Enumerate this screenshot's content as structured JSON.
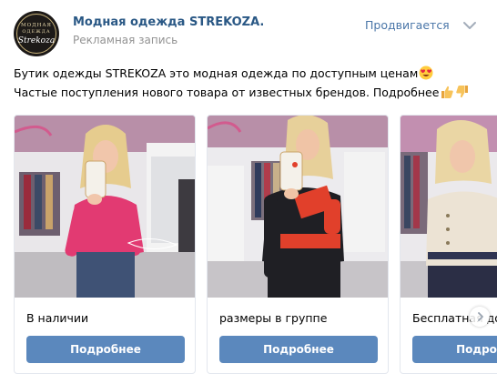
{
  "header": {
    "avatar": {
      "logo_line1": "МОДНАЯ",
      "logo_line2": "ОДЕЖДА",
      "logo_script": "Strekoza"
    },
    "page_name": "Модная одежда STREKOZA.",
    "ad_label": "Рекламная запись",
    "promoted_label": "Продвигается",
    "menu_icon": "chevron-down-icon"
  },
  "post": {
    "text_line1": "Бутик одежды STREKOZA это модная одежда по доступным ценам",
    "text_line2": "Частые поступления нового товара от известных брендов. Подробнее",
    "emojis": [
      "heart-eyes-emoji",
      "thumbs-up-emoji",
      "thumbs-down-emoji"
    ]
  },
  "carousel": {
    "cards": [
      {
        "caption": "В наличии",
        "button": "Подробнее",
        "sweater_color": "#e23a72"
      },
      {
        "caption": "размеры в группе",
        "button": "Подробнее",
        "sweater_color": "#1f1f24"
      },
      {
        "caption": "Бесплатная доставка",
        "button": "Подробнее",
        "sweater_color": "#ece3d4"
      }
    ],
    "next_icon": "chevron-right-icon"
  },
  "colors": {
    "link": "#2a5885",
    "promoted": "#4a76a8",
    "button": "#5b88bd",
    "muted": "#939393"
  }
}
